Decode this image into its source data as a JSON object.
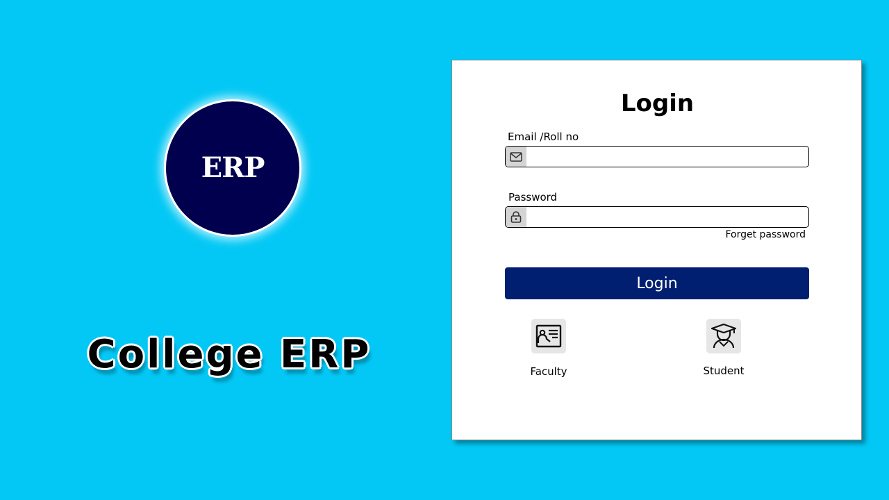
{
  "brand": {
    "logo_text": "ERP",
    "app_title": "College ERP"
  },
  "login_form": {
    "title": "Login",
    "email_label": "Email /Roll no",
    "email_value": "",
    "password_label": "Password",
    "password_value": "",
    "forgot_password": "Forget password",
    "submit_label": "Login"
  },
  "roles": [
    {
      "label": "Faculty",
      "icon": "faculty-teacher-icon"
    },
    {
      "label": "Student",
      "icon": "student-graduate-icon"
    }
  ],
  "colors": {
    "background": "#03c8f5",
    "logo_circle": "#01004f",
    "login_button": "#001f70",
    "card": "#ffffff"
  }
}
